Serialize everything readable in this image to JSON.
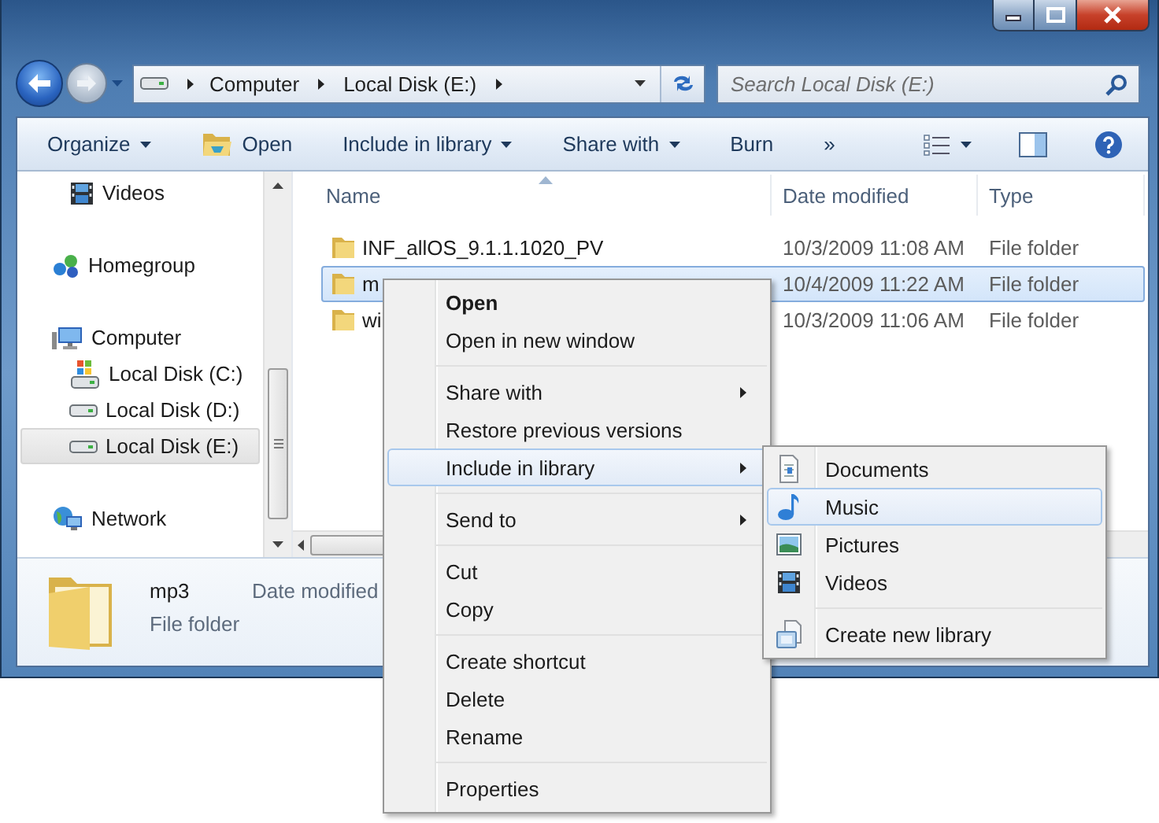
{
  "address_bar": {
    "breadcrumbs": [
      "Computer",
      "Local Disk (E:)"
    ]
  },
  "search": {
    "placeholder": "Search Local Disk (E:)"
  },
  "toolbar": {
    "items": [
      {
        "label": "Organize",
        "kind": "dropdown"
      },
      {
        "label": "Open",
        "kind": "icon"
      },
      {
        "label": "Include in library",
        "kind": "dropdown"
      },
      {
        "label": "Share with",
        "kind": "dropdown"
      },
      {
        "label": "Burn",
        "kind": "plain"
      },
      {
        "label": "»",
        "kind": "plain"
      }
    ]
  },
  "nav_pane": {
    "items": [
      {
        "children": [
          {
            "label": "Videos",
            "kind": "videos",
            "selected": false
          }
        ]
      },
      {
        "label": "Homegroup",
        "kind": "homegroup",
        "selected": false
      },
      {
        "label": "Computer",
        "kind": "computer",
        "selected": false,
        "children": [
          {
            "label": "Local Disk (C:)",
            "kind": "system-drive",
            "selected": false
          },
          {
            "label": "Local Disk (D:)",
            "kind": "drive",
            "selected": false
          },
          {
            "label": "Local Disk (E:)",
            "kind": "drive",
            "selected": true
          }
        ]
      },
      {
        "label": "Network",
        "kind": "network",
        "selected": false
      }
    ]
  },
  "file_list": {
    "columns": [
      {
        "label": "Name",
        "sorted": true
      },
      {
        "label": "Date modified",
        "sorted": false
      },
      {
        "label": "Type",
        "sorted": false
      }
    ],
    "rows": [
      {
        "name": "INF_allOS_9.1.1.1020_PV",
        "date": "10/3/2009 11:08 AM",
        "type": "File folder",
        "selected": false
      },
      {
        "name": "m",
        "date": "10/4/2009 11:22 AM",
        "type": "File folder",
        "selected": true
      },
      {
        "name": "wi",
        "date": "10/3/2009 11:06 AM",
        "type": "File folder",
        "selected": false
      }
    ]
  },
  "details": {
    "name": "mp3",
    "type": "File folder",
    "field_label": "Date modified"
  },
  "context_menu": {
    "groups": [
      [
        {
          "label": "Open",
          "default": true,
          "submenu": false,
          "selected": false
        },
        {
          "label": "Open in new window",
          "default": false,
          "submenu": false,
          "selected": false
        }
      ],
      [
        {
          "label": "Share with",
          "default": false,
          "submenu": true,
          "selected": false
        },
        {
          "label": "Restore previous versions",
          "default": false,
          "submenu": false,
          "selected": false
        },
        {
          "label": "Include in library",
          "default": false,
          "submenu": true,
          "selected": true
        }
      ],
      [
        {
          "label": "Send to",
          "default": false,
          "submenu": true,
          "selected": false
        }
      ],
      [
        {
          "label": "Cut",
          "default": false,
          "submenu": false,
          "selected": false
        },
        {
          "label": "Copy",
          "default": false,
          "submenu": false,
          "selected": false
        }
      ],
      [
        {
          "label": "Create shortcut",
          "default": false,
          "submenu": false,
          "selected": false
        },
        {
          "label": "Delete",
          "default": false,
          "submenu": false,
          "selected": false
        },
        {
          "label": "Rename",
          "default": false,
          "submenu": false,
          "selected": false
        }
      ],
      [
        {
          "label": "Properties",
          "default": false,
          "submenu": false,
          "selected": false
        }
      ]
    ]
  },
  "submenu": {
    "groups": [
      [
        {
          "label": "Documents",
          "kind": "documents",
          "selected": false
        },
        {
          "label": "Music",
          "kind": "music",
          "selected": true
        },
        {
          "label": "Pictures",
          "kind": "pictures",
          "selected": false
        },
        {
          "label": "Videos",
          "kind": "videos",
          "selected": false
        }
      ],
      [
        {
          "label": "Create new library",
          "kind": "library",
          "selected": false
        }
      ]
    ]
  }
}
